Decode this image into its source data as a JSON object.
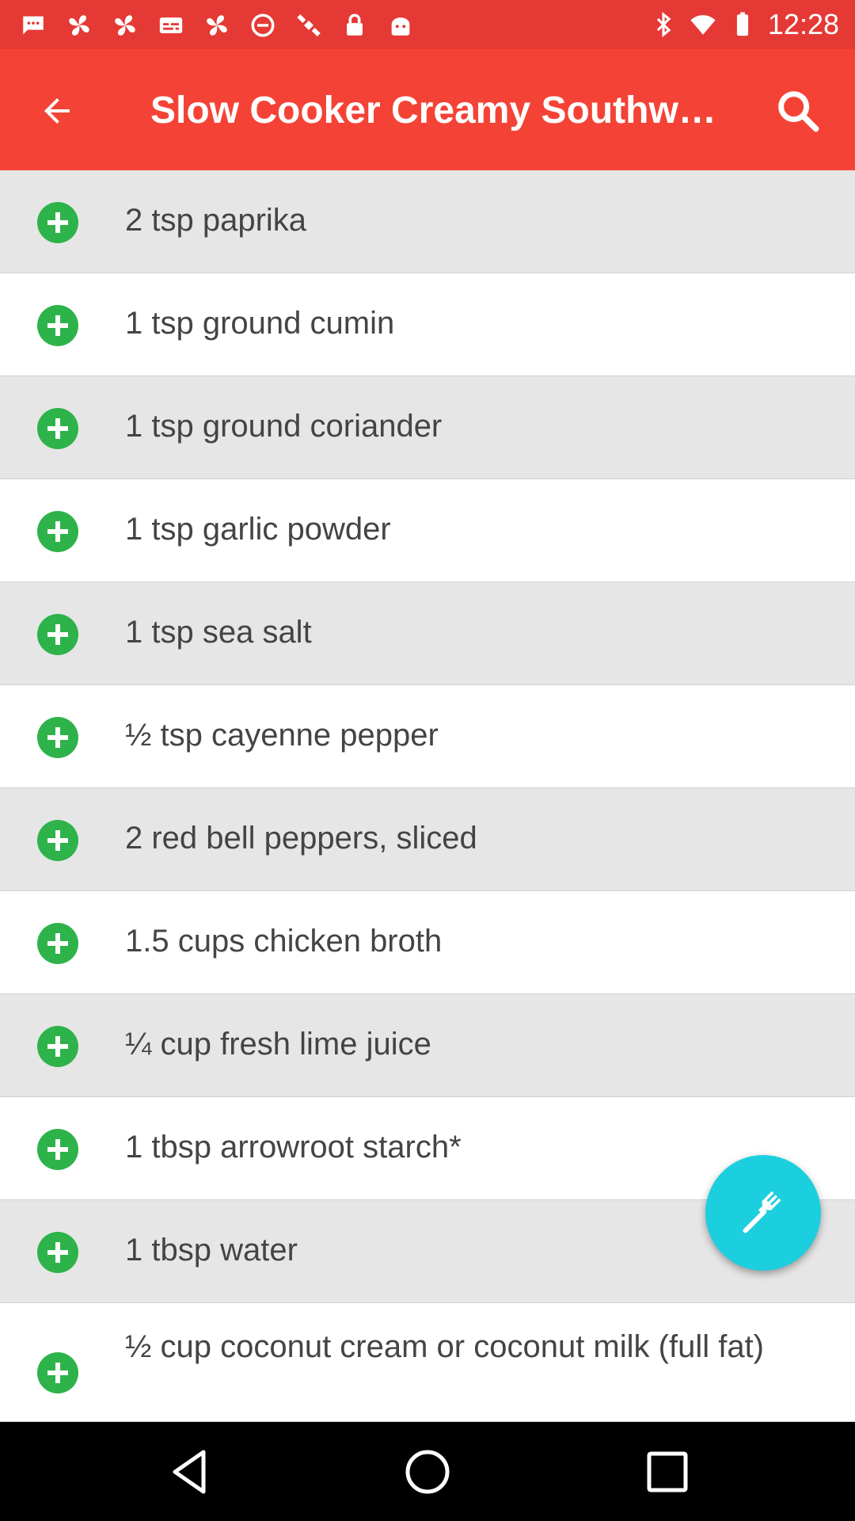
{
  "status_bar": {
    "time": "12:28",
    "left_icons": [
      "message-icon",
      "fan-icon",
      "fan-icon",
      "subtitles-icon",
      "fan-icon",
      "block-icon",
      "satellite-icon",
      "lock-icon",
      "android-icon"
    ],
    "right_icons": [
      "bluetooth-icon",
      "wifi-icon",
      "battery-icon"
    ]
  },
  "app_bar": {
    "title": "Slow Cooker Creamy Southw…",
    "back_icon": "arrow-back-icon",
    "search_icon": "search-icon"
  },
  "ingredients": [
    {
      "text": "2 tsp paprika"
    },
    {
      "text": "1 tsp ground cumin"
    },
    {
      "text": "1 tsp ground coriander"
    },
    {
      "text": "1 tsp garlic powder"
    },
    {
      "text": "1 tsp sea salt"
    },
    {
      "text": "½ tsp cayenne pepper"
    },
    {
      "text": "2 red bell peppers, sliced"
    },
    {
      "text": "1.5 cups chicken broth"
    },
    {
      "text": "¼ cup fresh lime juice"
    },
    {
      "text": "1 tbsp arrowroot starch*"
    },
    {
      "text": "1 tbsp water"
    },
    {
      "text": "½ cup coconut cream or coconut milk (full fat)"
    }
  ],
  "fab": {
    "icon": "fork-icon"
  },
  "nav_bar": {
    "icons": [
      "nav-back-icon",
      "nav-home-icon",
      "nav-recents-icon"
    ]
  },
  "colors": {
    "app_bar": "#f44336",
    "status_bar": "#e53935",
    "add_icon": "#2db34a",
    "fab": "#1ccfdf",
    "row_shaded": "#e6e6e6",
    "text": "#444444"
  }
}
